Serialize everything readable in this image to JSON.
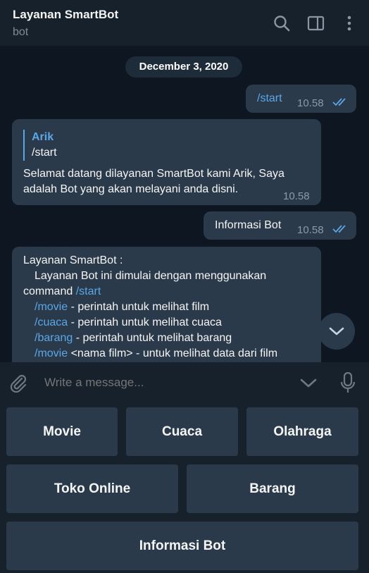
{
  "header": {
    "title": "Layanan SmartBot",
    "subtitle": "bot",
    "icons": [
      "search-icon",
      "sidebar-toggle-icon",
      "more-vertical-icon"
    ]
  },
  "chat": {
    "date": "December 3, 2020",
    "messages": [
      {
        "direction": "out",
        "text": "/start",
        "time": "10.58",
        "status": "read"
      },
      {
        "direction": "in",
        "reply_name": "Arik",
        "reply_text": "/start",
        "text": "Selamat datang dilayanan SmartBot kami Arik, Saya adalah Bot yang akan melayani anda disni.",
        "time": "10.58"
      },
      {
        "direction": "out",
        "text": "Informasi Bot",
        "time": "10.58",
        "status": "read"
      },
      {
        "direction": "in",
        "line1": "Layanan SmartBot :",
        "line2": "Layanan Bot ini dimulai dengan menggunakan",
        "line3_prefix": "command ",
        "line3_cmd": "/start",
        "cmds": [
          {
            "cmd": "/movie",
            "desc": " - perintah untuk melihat film"
          },
          {
            "cmd": "/cuaca",
            "desc": " - perintah untuk melihat cuaca"
          },
          {
            "cmd": "/barang",
            "desc": " - perintah untuk melihat barang"
          },
          {
            "cmd": "/movie",
            "desc": " <nama film> - untuk melihat data dari film"
          }
        ]
      }
    ]
  },
  "composer": {
    "placeholder": "Write a message..."
  },
  "keyboard": {
    "row1": [
      "Movie",
      "Cuaca",
      "Olahraga"
    ],
    "row2": [
      "Toko Online",
      "Barang"
    ],
    "row3": [
      "Informasi Bot"
    ]
  },
  "colors": {
    "background": "#0e1621",
    "header": "#17212b",
    "bubble": "#2b3a4b",
    "link": "#5aa7e6",
    "check": "#5aa7e6"
  }
}
